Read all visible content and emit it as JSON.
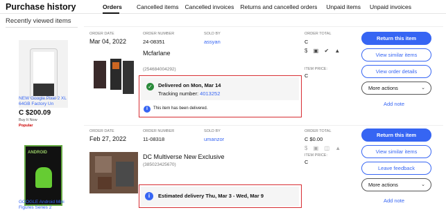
{
  "header": {
    "title": "Purchase history",
    "tabs": [
      {
        "label": "Orders",
        "active": true
      },
      {
        "label": "Cancelled items",
        "active": false
      },
      {
        "label": "Cancelled invoices",
        "active": false
      },
      {
        "label": "Returns and cancelled orders",
        "active": false
      },
      {
        "label": "Unpaid items",
        "active": false
      },
      {
        "label": "Unpaid invoices",
        "active": false
      }
    ]
  },
  "sidebar": {
    "title": "Recently viewed items",
    "items": [
      {
        "title": "NEW Google Pixel 2 XL 64GB Factory Un",
        "price": "C $200.09",
        "buy": "Buy It Now",
        "badge": "Popular"
      },
      {
        "title": "GOOGLE Android Mini Figures Series 2",
        "image_text": "ANDROID"
      }
    ]
  },
  "orders": [
    {
      "date_label": "ORDER DATE",
      "date": "Mar 04, 2022",
      "number_label": "ORDER NUMBER",
      "number": "24-08351",
      "sold_by_label": "SOLD BY",
      "sold_by": "assyan",
      "total_label": "ORDER TOTAL",
      "total": "C",
      "item_title": "Mcfarlane",
      "item_sub": "(254684004292)",
      "item_price_label": "ITEM PRICE:",
      "item_price": "C",
      "status_main": "Delivered on Mon, Mar 14",
      "tracking_label": "Tracking number:",
      "tracking_number": "4013252",
      "status_note": "This item has been delivered.",
      "icons": "$ ▣ ✔ ▲",
      "buttons": {
        "primary": "Return this item",
        "secondary1": "View similar items",
        "secondary2": "View order details",
        "more": "More actions",
        "note": "Add note"
      }
    },
    {
      "date_label": "ORDER DATE",
      "date": "Feb 27, 2022",
      "number_label": "ORDER NUMBER",
      "number": "11-08318",
      "sold_by_label": "SOLD BY",
      "sold_by": "umanzor",
      "total_label": "ORDER TOTAL",
      "total": "C $0.00",
      "item_title": "DC Multiverse New Exclusive",
      "item_sub": "(385023425670)",
      "item_price_label": "ITEM PRICE:",
      "item_price": "C",
      "status_main": "Estimated delivery Thu, Mar 3 - Wed, Mar 9",
      "icons": "$ ▣ ◫ ▲",
      "buttons": {
        "primary": "Return this item",
        "secondary1": "View similar items",
        "secondary2": "Leave feedback",
        "more": "More actions",
        "note": "Add note"
      }
    }
  ],
  "colors": {
    "accent": "#3665f3",
    "highlight": "#d62b30",
    "success": "#2a8a3a"
  }
}
